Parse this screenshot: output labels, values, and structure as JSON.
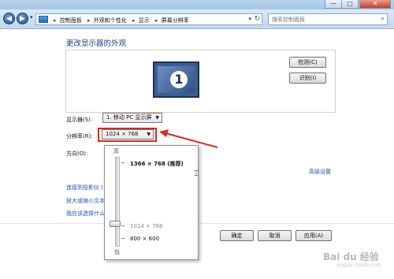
{
  "window": {
    "controls": {
      "minimize": "—",
      "maximize": "□",
      "close": "✕"
    }
  },
  "nav": {
    "back": "◀",
    "forward": "▶",
    "history_dropdown": "▾",
    "breadcrumbs": [
      "控制面板",
      "外观和个性化",
      "显示",
      "屏幕分辨率"
    ],
    "breadcrumb_separator": "▸",
    "search_placeholder": "搜索控制面板",
    "icons": {
      "folder": "control-panel-icon",
      "refresh": "↻",
      "search": "⌕"
    }
  },
  "page": {
    "title": "更改显示器的外观",
    "monitor_number": "1",
    "detect_label": "检测(C)",
    "identify_label": "识别(I)",
    "display_label": "显示器(S):",
    "display_value": "1. 移动 PC 显示屏",
    "resolution_label": "分辨率(R):",
    "resolution_value": "1024 × 768",
    "orientation_label": "方向(O):",
    "advanced_link": "高级设置",
    "links": [
      "连接到投影仪 (",
      "放大或缩小文本",
      "我应该选择什么"
    ],
    "ok_label": "确定",
    "cancel_label": "取消",
    "apply_label": "应用(A)"
  },
  "resolution_dropdown": {
    "high_label": "高",
    "low_label": "低",
    "options": [
      {
        "label": "1366 × 768 (推荐)",
        "style": "bold"
      },
      {
        "label": "1024 × 768",
        "style": "grey"
      },
      {
        "label": "800 × 600",
        "style": "normal"
      }
    ],
    "selected": "1024 × 768"
  },
  "annotation": {
    "highlight_color": "#e0261b"
  },
  "watermark": {
    "text": "Bai du 经验",
    "sub": "jingyan.baidu.com"
  },
  "colors": {
    "title_blue": "#1e3d8a",
    "link_blue": "#1a55b8",
    "window_frame": "#c7dcee"
  }
}
